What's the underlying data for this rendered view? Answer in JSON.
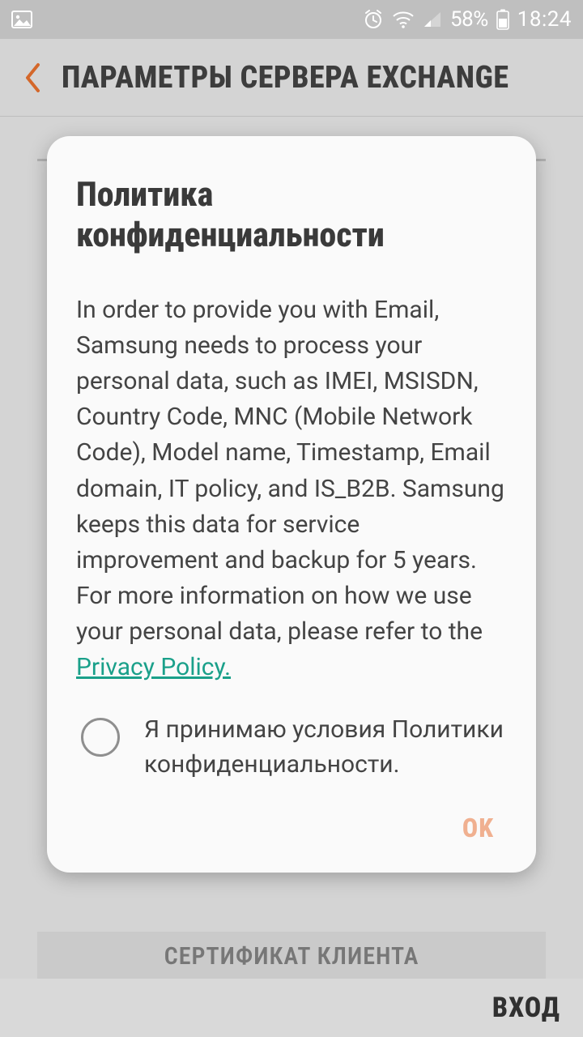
{
  "status": {
    "battery_percent": "58%",
    "time": "18:24"
  },
  "appbar": {
    "title": "ПАРАМЕТРЫ СЕРВЕРА EXCHANGE"
  },
  "background": {
    "cert_button": "СЕРТИФИКАТ КЛИЕНТА",
    "login_button": "ВХОД"
  },
  "dialog": {
    "title": "Политика конфиденциальности",
    "body_prefix": "In order to provide you with Email, Samsung needs to process your personal data, such as IMEI, MSISDN, Country Code, MNC (Mobile Network Code), Model name, Timestamp, Email domain, IT policy, and IS_B2B. Samsung keeps this data for service improvement and backup for 5 years. For more information on how we use your personal data, please refer to the ",
    "body_link": "Privacy Policy.",
    "accept_text": "Я принимаю условия Политики конфиденциальности.",
    "ok_label": "OK"
  }
}
